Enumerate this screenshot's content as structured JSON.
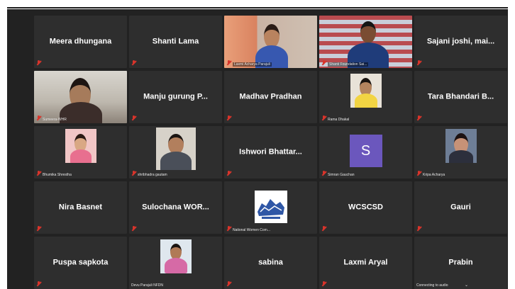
{
  "app": {
    "accent": "#d9342b",
    "tile_bg": "#2e2e2e",
    "stage_bg": "#222222"
  },
  "tiles": [
    {
      "name": "Meera dhungana"
    },
    {
      "name": "Shanti Lama"
    },
    {
      "label": "Laxmi Acharya Parajuli"
    },
    {
      "label": "Shanti Foundation Sai..."
    },
    {
      "name": "Sajani joshi, mai..."
    },
    {
      "label": "Sumeera-WHR"
    },
    {
      "name": "Manju gurung P..."
    },
    {
      "name": "Madhav Pradhan"
    },
    {
      "label": "Rama Dhakal"
    },
    {
      "name": "Tara Bhandari B..."
    },
    {
      "label": "Bhumika Shrestha"
    },
    {
      "label": "shribhadra gautam"
    },
    {
      "name": "Ishwori Bhattar..."
    },
    {
      "label": "Simran Gauchan",
      "avatar_letter": "S"
    },
    {
      "label": "Kripa Acharya"
    },
    {
      "name": "Nira Basnet"
    },
    {
      "name": "Sulochana WOR..."
    },
    {
      "label": "National Women Com..."
    },
    {
      "name": "WCSCSD"
    },
    {
      "name": "Gauri"
    },
    {
      "name": "Puspa sapkota"
    },
    {
      "label": "Devu Parajuli NFDN"
    },
    {
      "name": "sabina"
    },
    {
      "name": "Laxmi Aryal"
    },
    {
      "name": "Prabin",
      "status": "Connecting to audio"
    }
  ]
}
